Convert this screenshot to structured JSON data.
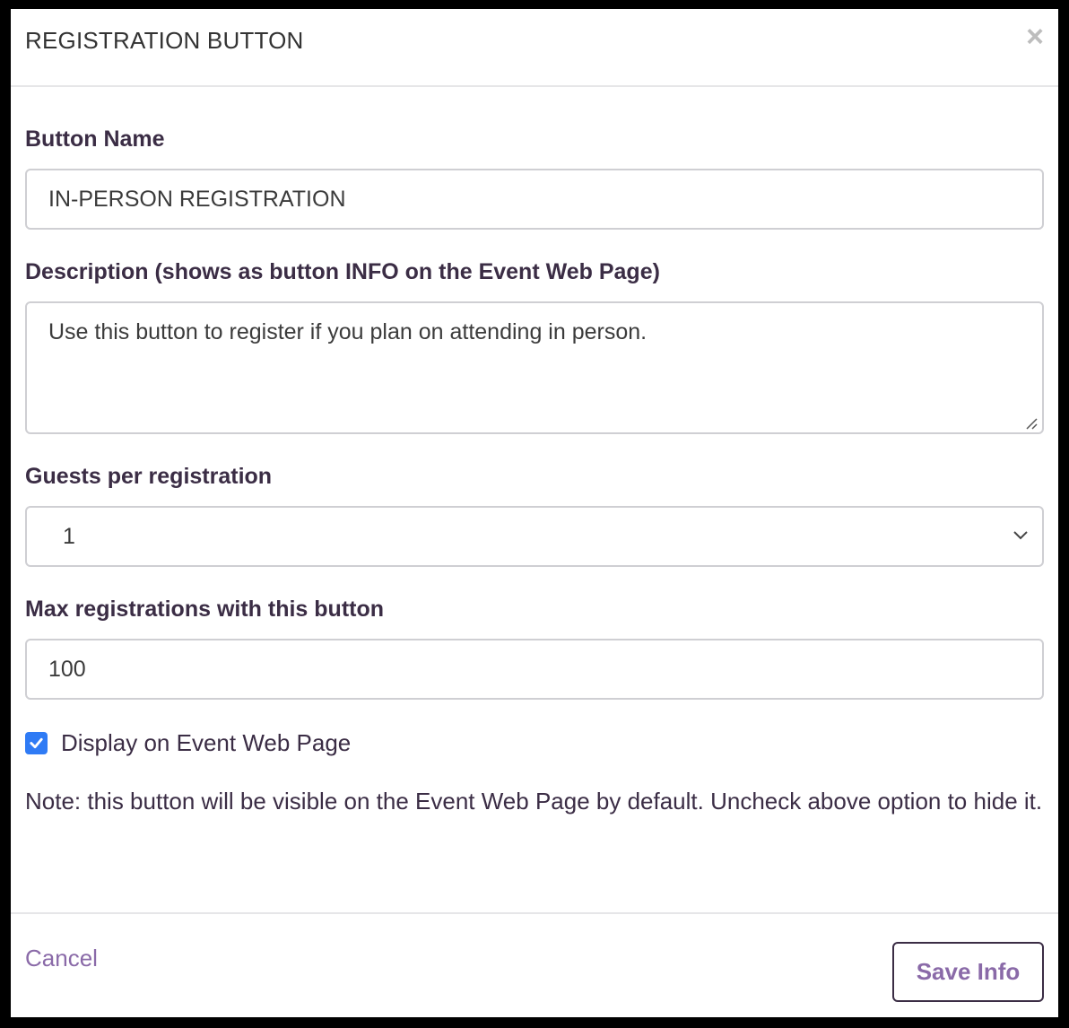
{
  "header": {
    "title": "REGISTRATION BUTTON",
    "close_symbol": "×"
  },
  "form": {
    "button_name": {
      "label": "Button Name",
      "value": "IN-PERSON REGISTRATION"
    },
    "description": {
      "label": "Description (shows as button INFO on the Event Web Page)",
      "value": "Use this button to register if you plan on attending in person."
    },
    "guests": {
      "label": "Guests per registration",
      "selected": "1"
    },
    "max_registrations": {
      "label": "Max registrations with this button",
      "value": "100"
    },
    "display_checkbox": {
      "label": "Display on Event Web Page",
      "checked": true
    },
    "note": "Note: this button will be visible on the Event Web Page by default. Uncheck above option to hide it."
  },
  "footer": {
    "cancel_label": "Cancel",
    "save_label": "Save Info"
  },
  "colors": {
    "accent": "#8a6aa8",
    "label_text": "#3b2d45",
    "checkbox": "#2f7bf5",
    "border": "#cfcfd3"
  },
  "icons": {
    "close": "close-icon",
    "select_chevron": "chevron-down-icon",
    "checkbox_check": "check-icon",
    "resize": "resize-grip-icon"
  }
}
